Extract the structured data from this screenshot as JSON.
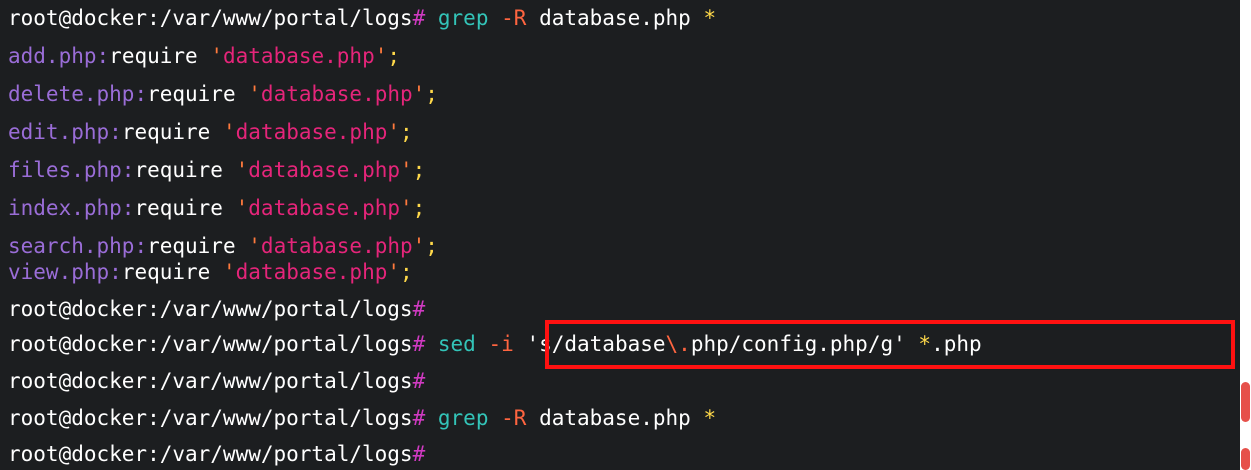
{
  "colors": {
    "background": "#1c1e20",
    "prompt": "#ffffff",
    "hash": "#d03ac2",
    "command": "#33c4b8",
    "flag": "#ff6540",
    "filename": "#9a6dd7",
    "string": "#e5257a",
    "quote": "#ff7a3d",
    "semicolon": "#ffd94a",
    "highlight_border": "#ff1111"
  },
  "prompt": "root@docker:/var/www/portal/logs",
  "hash": "#",
  "grep": {
    "cmd": "grep",
    "flag": "-R",
    "pattern": "database.php",
    "glob": "*"
  },
  "results": [
    {
      "file": "add.php",
      "keyword": "require",
      "value": "database.php"
    },
    {
      "file": "delete.php",
      "keyword": "require",
      "value": "database.php"
    },
    {
      "file": "edit.php",
      "keyword": "require",
      "value": "database.php"
    },
    {
      "file": "files.php",
      "keyword": "require",
      "value": "database.php"
    },
    {
      "file": "index.php",
      "keyword": "require",
      "value": "database.php"
    },
    {
      "file": "search.php",
      "keyword": "require",
      "value": "database.php"
    },
    {
      "file": "view.php",
      "keyword": "require",
      "value": "database.php"
    }
  ],
  "sed": {
    "cmd": "sed",
    "flag": "-i",
    "expr_start": "'s/database",
    "expr_escape": "\\.",
    "expr_end": "php/config.php/g'",
    "glob_star": "*",
    "glob_ext": ".php"
  },
  "punct": {
    "colon": ":",
    "quote": "'",
    "semicolon": ";"
  }
}
